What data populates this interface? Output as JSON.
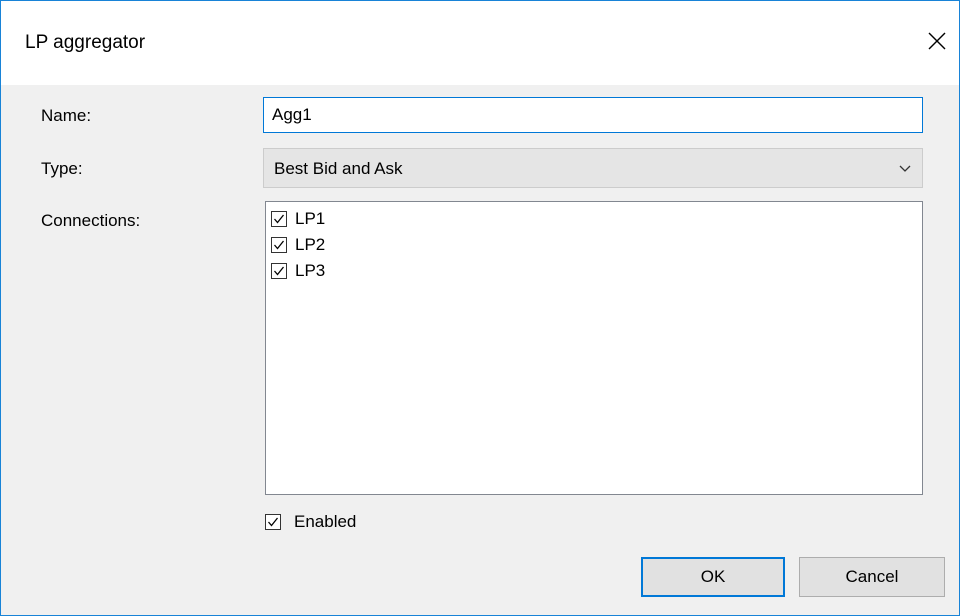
{
  "window": {
    "title": "LP aggregator",
    "close_icon": "close-icon"
  },
  "form": {
    "name_label": "Name:",
    "name_value": "Agg1",
    "type_label": "Type:",
    "type_value": "Best Bid and Ask",
    "connections_label": "Connections:"
  },
  "connections": [
    {
      "label": "LP1",
      "checked": true
    },
    {
      "label": "LP2",
      "checked": true
    },
    {
      "label": "LP3",
      "checked": true
    }
  ],
  "enabled": {
    "label": "Enabled",
    "checked": true
  },
  "buttons": {
    "ok_label": "OK",
    "cancel_label": "Cancel"
  },
  "colors": {
    "accent": "#0078d7",
    "window_border": "#1883d7",
    "dialog_background": "#f0f0f0"
  }
}
